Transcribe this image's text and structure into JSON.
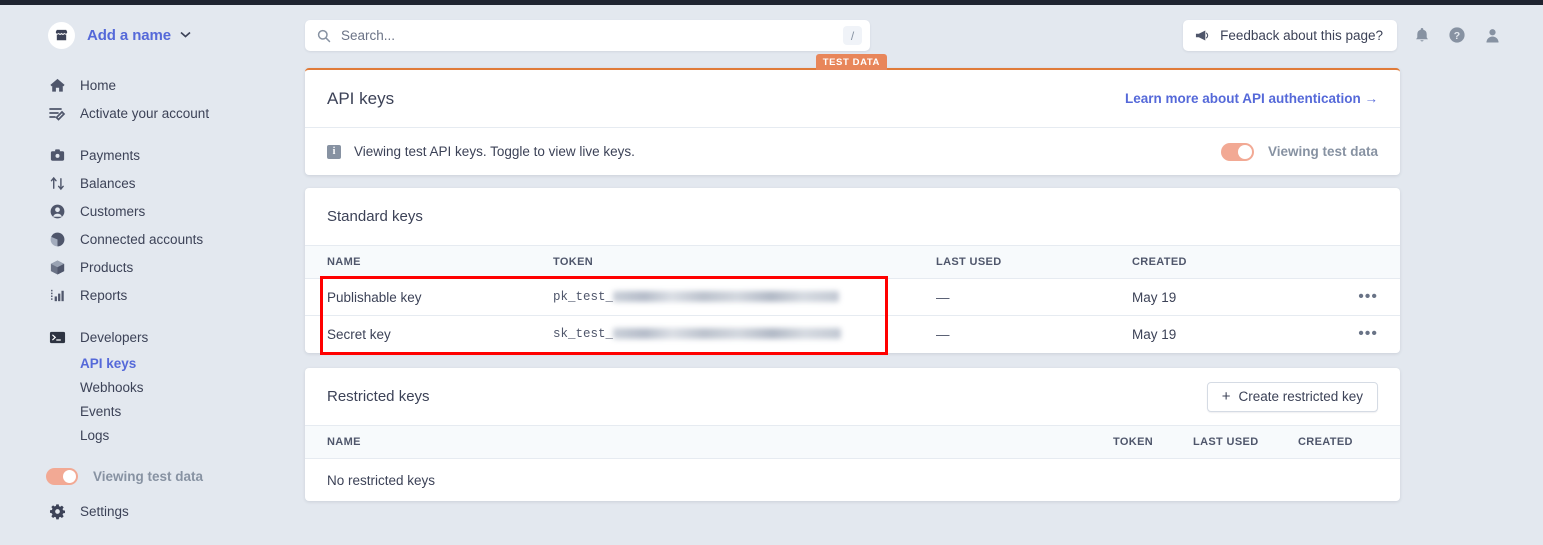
{
  "sidebar": {
    "brand": {
      "name": "Add a name",
      "logo_icon": "store-icon",
      "caret_icon": "chevron-down-icon"
    },
    "groups": [
      {
        "items": [
          {
            "label": "Home",
            "icon": "home-icon"
          },
          {
            "label": "Activate your account",
            "icon": "activate-account-icon"
          }
        ]
      },
      {
        "items": [
          {
            "label": "Payments",
            "icon": "payments-icon"
          },
          {
            "label": "Balances",
            "icon": "balances-icon"
          },
          {
            "label": "Customers",
            "icon": "customers-icon"
          },
          {
            "label": "Connected accounts",
            "icon": "connected-accounts-icon"
          },
          {
            "label": "Products",
            "icon": "products-icon"
          },
          {
            "label": "Reports",
            "icon": "reports-icon"
          }
        ]
      },
      {
        "items": [
          {
            "label": "Developers",
            "icon": "developers-terminal-icon"
          }
        ],
        "sub_items": [
          {
            "label": "API keys",
            "active": true
          },
          {
            "label": "Webhooks",
            "active": false
          },
          {
            "label": "Events",
            "active": false
          },
          {
            "label": "Logs",
            "active": false
          }
        ]
      }
    ],
    "test_toggle": {
      "label": "Viewing test data",
      "on": true
    },
    "settings": {
      "label": "Settings",
      "icon": "gear-icon"
    }
  },
  "header": {
    "search": {
      "placeholder": "Search...",
      "value": "",
      "icon": "search-icon",
      "shortcut": "/"
    },
    "feedback_button": {
      "label": "Feedback about this page?",
      "icon": "megaphone-icon"
    },
    "icons": [
      {
        "name": "bell-icon"
      },
      {
        "name": "help-circle-icon"
      },
      {
        "name": "user-avatar-icon"
      }
    ]
  },
  "api_keys_card": {
    "title": "API keys",
    "test_badge": "TEST DATA",
    "learn_link": "Learn more about API authentication →",
    "notice": "Viewing test API keys. Toggle to view live keys.",
    "toggle_label": "Viewing test data",
    "accent_color": "#e07b39"
  },
  "standard_keys": {
    "title": "Standard keys",
    "columns": [
      "NAME",
      "TOKEN",
      "LAST USED",
      "CREATED"
    ],
    "rows": [
      {
        "name": "Publishable key",
        "token_prefix": "pk_test_",
        "token_redacted": true,
        "last_used": "—",
        "created": "May 19",
        "menu": "•••"
      },
      {
        "name": "Secret key",
        "token_prefix": "sk_test_",
        "token_redacted": true,
        "last_used": "—",
        "created": "May 19",
        "menu": "•••"
      }
    ]
  },
  "restricted_keys": {
    "title": "Restricted keys",
    "create_button": "Create restricted key",
    "columns": [
      "NAME",
      "TOKEN",
      "LAST USED",
      "CREATED"
    ],
    "empty_text": "No restricted keys"
  },
  "annotation": {
    "highlight_color": "#ff0000"
  }
}
